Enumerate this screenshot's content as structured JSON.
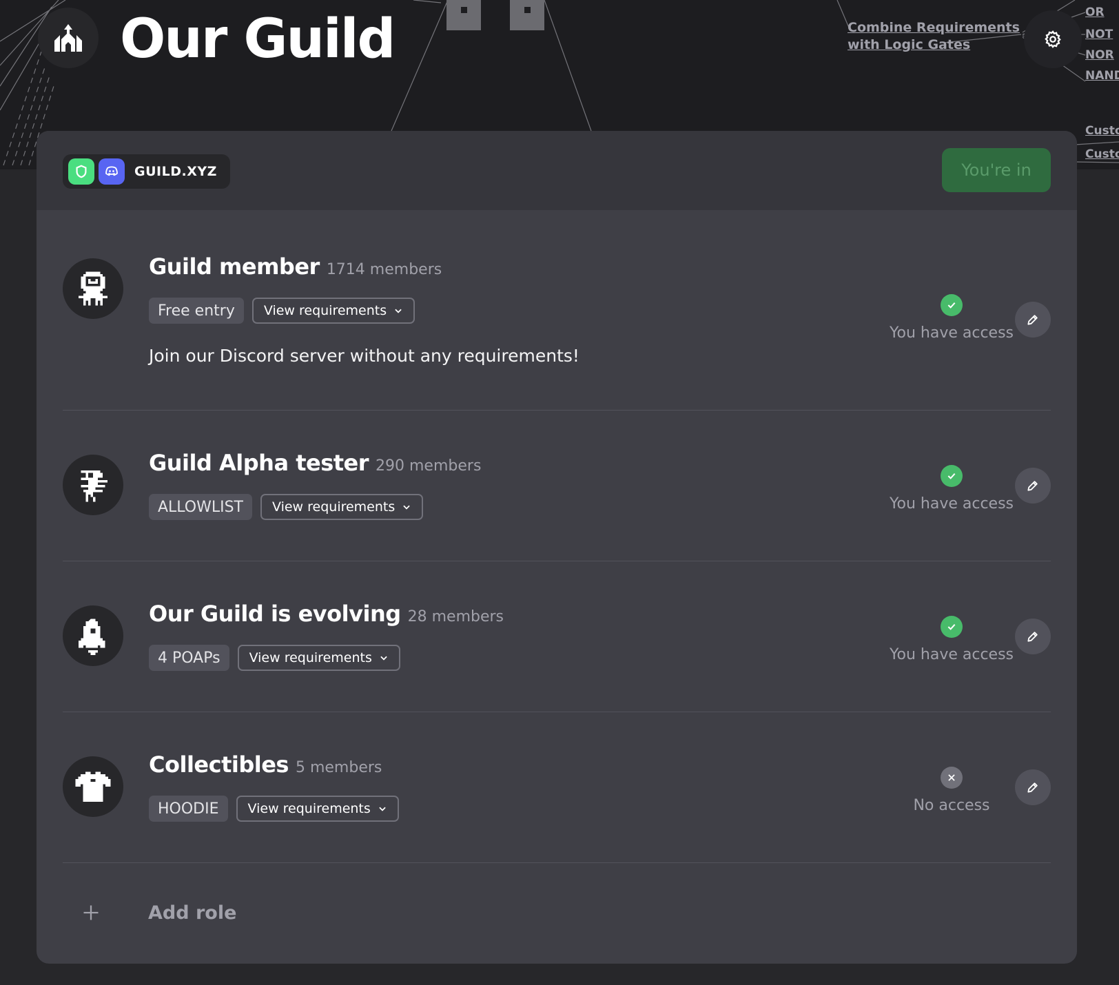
{
  "guild": {
    "name": "Our Guild",
    "logo_icon": "castle-icon"
  },
  "promo": {
    "line1": "Combine Requirements",
    "line2": "with Logic Gates",
    "icon": "gear-icon",
    "gates": [
      "OR",
      "NOT",
      "NOR",
      "NAND"
    ],
    "custom": [
      "Custo",
      "Custo"
    ]
  },
  "header": {
    "platform_name": "GUILD.XYZ",
    "platform_icons": [
      "shield-icon",
      "discord-icon"
    ],
    "join_status": "You're in"
  },
  "roles": [
    {
      "name": "Guild member",
      "members": "1714 members",
      "tag": "Free entry",
      "view_label": "View requirements",
      "description": "Join our Discord server without any requirements!",
      "access": "You have access",
      "has_access": true,
      "avatar_icon": "robot-icon"
    },
    {
      "name": "Guild Alpha tester",
      "members": "290 members",
      "tag": "ALLOWLIST",
      "view_label": "View requirements",
      "access": "You have access",
      "has_access": true,
      "avatar_icon": "pixel-bird-icon"
    },
    {
      "name": "Our Guild is evolving",
      "members": "28 members",
      "tag": "4 POAPs",
      "view_label": "View requirements",
      "access": "You have access",
      "has_access": true,
      "avatar_icon": "rocket-icon"
    },
    {
      "name": "Collectibles",
      "members": "5 members",
      "tag": "HOODIE",
      "view_label": "View requirements",
      "access": "No access",
      "has_access": false,
      "avatar_icon": "tshirt-icon"
    }
  ],
  "add_role": {
    "label": "Add role"
  },
  "colors": {
    "background": "#27272a",
    "hero": "#1d1d20",
    "card": "#3f3f46",
    "access_ok": "#48bb6a",
    "joined_button": "#2f6b3f"
  }
}
